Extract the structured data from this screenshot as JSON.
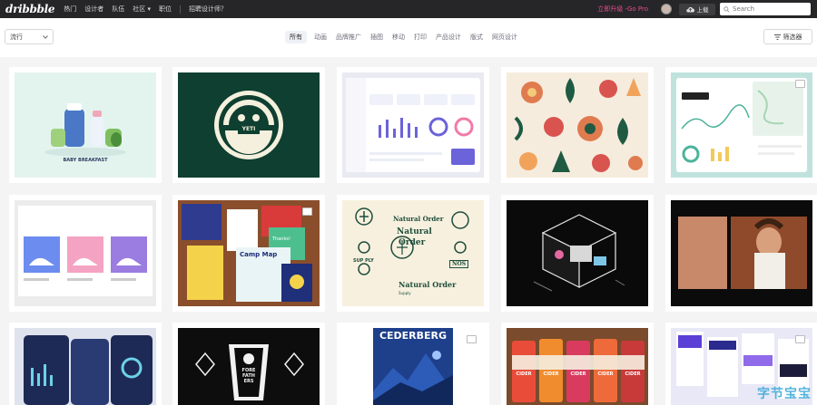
{
  "header": {
    "logo": "dribbble",
    "nav": [
      "热门",
      "设计者",
      "队伍",
      "社区",
      "职位"
    ],
    "community_caret": "▾",
    "hiring": "招聘设计师？",
    "upgrade": "立即升级 -Go Pro",
    "upload": "上载",
    "search_placeholder": "Search"
  },
  "filterbar": {
    "sort_label": "流行",
    "categories": [
      "所有",
      "动画",
      "品牌推广",
      "插图",
      "移动",
      "打印",
      "产品设计",
      "版式",
      "网页设计"
    ],
    "active_category": "所有",
    "filters_label": "筛选器"
  },
  "shots": {
    "baby_title": "BABY BREAKFAST",
    "yeti": "YETI",
    "camp_map": "Camp Map",
    "thanks": "Thanks!",
    "natural_order_1": "Natural Order",
    "natural_order_2": "Natural",
    "natural_order_3": "Order",
    "natural_order_supply": "Supply",
    "sup_ply": "SUP PLY",
    "nos": "NOS",
    "fore_fathers": "FORE FATH ERS",
    "cederberg": "CEDERBERG",
    "cider": "CIDER"
  },
  "watermark": "字节宝宝",
  "colors": {
    "nav_bg": "#262629",
    "accent_pink": "#ea4c89",
    "page_bg": "#f4f4f4"
  }
}
